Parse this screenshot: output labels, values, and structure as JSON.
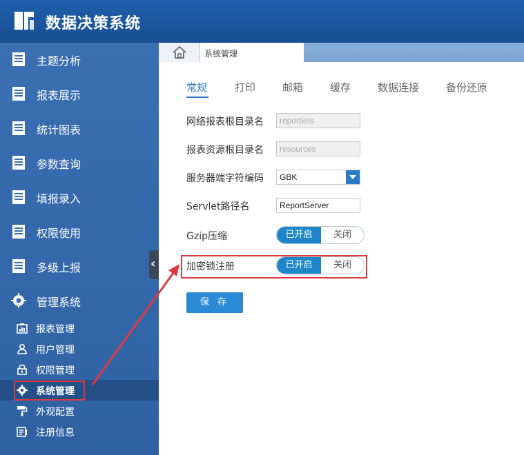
{
  "app": {
    "title": "数据决策系统",
    "logo_icon": "app-logo-icon",
    "header_color": "#1d5aa3",
    "accent_color": "#2a7cc7"
  },
  "sidebar": {
    "menu": [
      {
        "label": "主题分析",
        "icon": "document-icon"
      },
      {
        "label": "报表展示",
        "icon": "document-icon"
      },
      {
        "label": "统计图表",
        "icon": "document-icon"
      },
      {
        "label": "参数查询",
        "icon": "document-icon"
      },
      {
        "label": "填报录入",
        "icon": "document-icon"
      },
      {
        "label": "权限使用",
        "icon": "document-icon"
      },
      {
        "label": "多级上报",
        "icon": "document-icon"
      },
      {
        "label": "管理系统",
        "icon": "gear-icon"
      }
    ],
    "submenu": [
      {
        "label": "报表管理",
        "icon": "report-icon"
      },
      {
        "label": "用户管理",
        "icon": "user-icon"
      },
      {
        "label": "权限管理",
        "icon": "lock-icon"
      },
      {
        "label": "系统管理",
        "icon": "gear-icon",
        "active": true
      },
      {
        "label": "外观配置",
        "icon": "paint-roller-icon"
      },
      {
        "label": "注册信息",
        "icon": "register-icon"
      }
    ],
    "collapse_icon": "chevron-left-icon"
  },
  "tabbar": {
    "home_icon": "home-icon",
    "current_tab": "系统管理"
  },
  "settings": {
    "tabs": [
      "常规",
      "打印",
      "邮箱",
      "缓存",
      "数据连接",
      "备份还原"
    ],
    "active_tab": "常规",
    "report_root_label": "网络报表根目录名",
    "report_root_value": "reportlets",
    "resource_root_label": "报表资源根目录名",
    "resource_root_value": "resources",
    "charset_label": "服务器端字符编码",
    "charset_value": "GBK",
    "servlet_label": "Servlet路径名",
    "servlet_value": "ReportServer",
    "gzip_label": "Gzip压缩",
    "gzip_on": "已开启",
    "gzip_off": "关闭",
    "lock_label": "加密锁注册",
    "lock_on": "已开启",
    "lock_off": "关闭",
    "save_label": "保 存"
  }
}
